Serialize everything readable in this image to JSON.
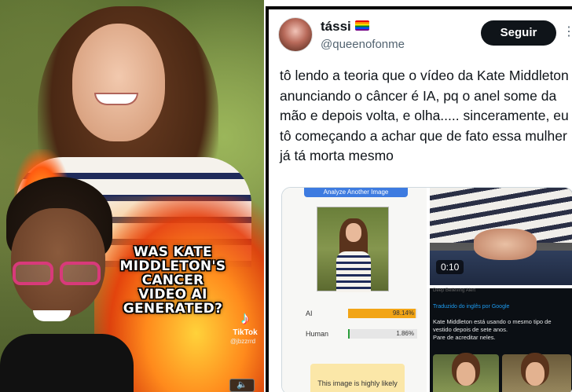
{
  "left_video": {
    "overlay_text": "WAS KATE\nMIDDLETON'S\nCANCER\nVIDEO AI\nGENERATED?",
    "platform_label": "TikTok",
    "platform_handle": "@jbzzrrd",
    "sound_icon": "speaker-icon",
    "sound_glyph": "🔈"
  },
  "tweet": {
    "display_name": "tássi",
    "name_emoji": "rainbow-flag",
    "handle": "@queenofonme",
    "follow_label": "Seguir",
    "more_glyph": "⋮",
    "text": "tô lendo a teoria que o vídeo da Kate Middleton anunciando o câncer é IA, pq o anel some da mão e depois volta, e olha..... sinceramente, eu tô começando a achar que de fato essa mulher já tá morta mesmo",
    "media": {
      "detector": {
        "top_button": "Analyze Another Image",
        "rows": [
          {
            "label": "AI",
            "value": "98.14%",
            "fraction": 0.9814,
            "color": "#f2a516"
          },
          {
            "label": "Human",
            "value": "1.86%",
            "fraction": 0.0186,
            "color": "#2a9d3a"
          }
        ],
        "result_text": "This image is highly likely"
      },
      "video": {
        "timestamp": "0:10"
      },
      "translated": {
        "top_line": "Deep Believing Alert",
        "source": "Traduzido do inglês por Google",
        "body": "Kate Middleton está usando o mesmo tipo de vestido depois de sete anos.\nPare de acreditar neles."
      }
    }
  }
}
